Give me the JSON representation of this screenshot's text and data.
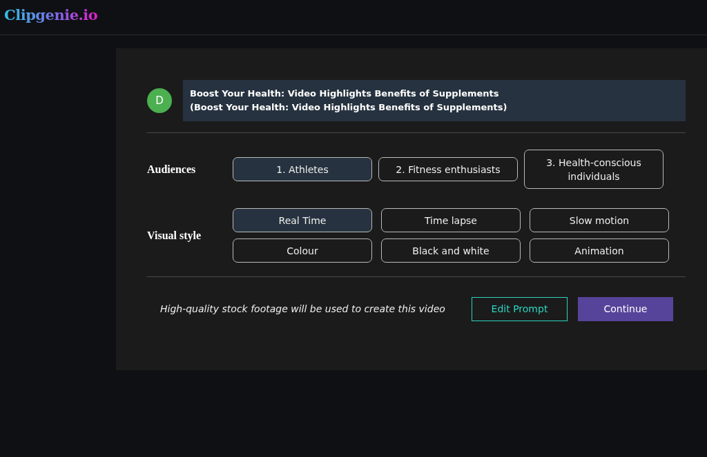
{
  "header": {
    "logo": "Clipgenie.io"
  },
  "prompt": {
    "avatar": "D",
    "lines": [
      "Boost Your Health: Video Highlights Benefits of Supplements",
      "(Boost Your Health: Video Highlights Benefits of Supplements)"
    ]
  },
  "audiences": {
    "label": "Audiences",
    "options": [
      {
        "label": "1. Athletes",
        "selected": true
      },
      {
        "label": "2. Fitness enthusiasts",
        "selected": false
      },
      {
        "label": "3. Health-conscious individuals",
        "selected": false
      }
    ]
  },
  "visual_style": {
    "label": "Visual style",
    "options": [
      {
        "label": "Real Time",
        "selected": true
      },
      {
        "label": "Time lapse",
        "selected": false
      },
      {
        "label": "Slow motion",
        "selected": false
      },
      {
        "label": "Colour",
        "selected": false
      },
      {
        "label": "Black and white",
        "selected": false
      },
      {
        "label": "Animation",
        "selected": false
      }
    ]
  },
  "footer": {
    "note": "High-quality stock footage will be used to create this video",
    "buttons": [
      {
        "label": "Edit Prompt",
        "kind": "outline"
      },
      {
        "label": "Continue",
        "kind": "primary"
      }
    ]
  }
}
